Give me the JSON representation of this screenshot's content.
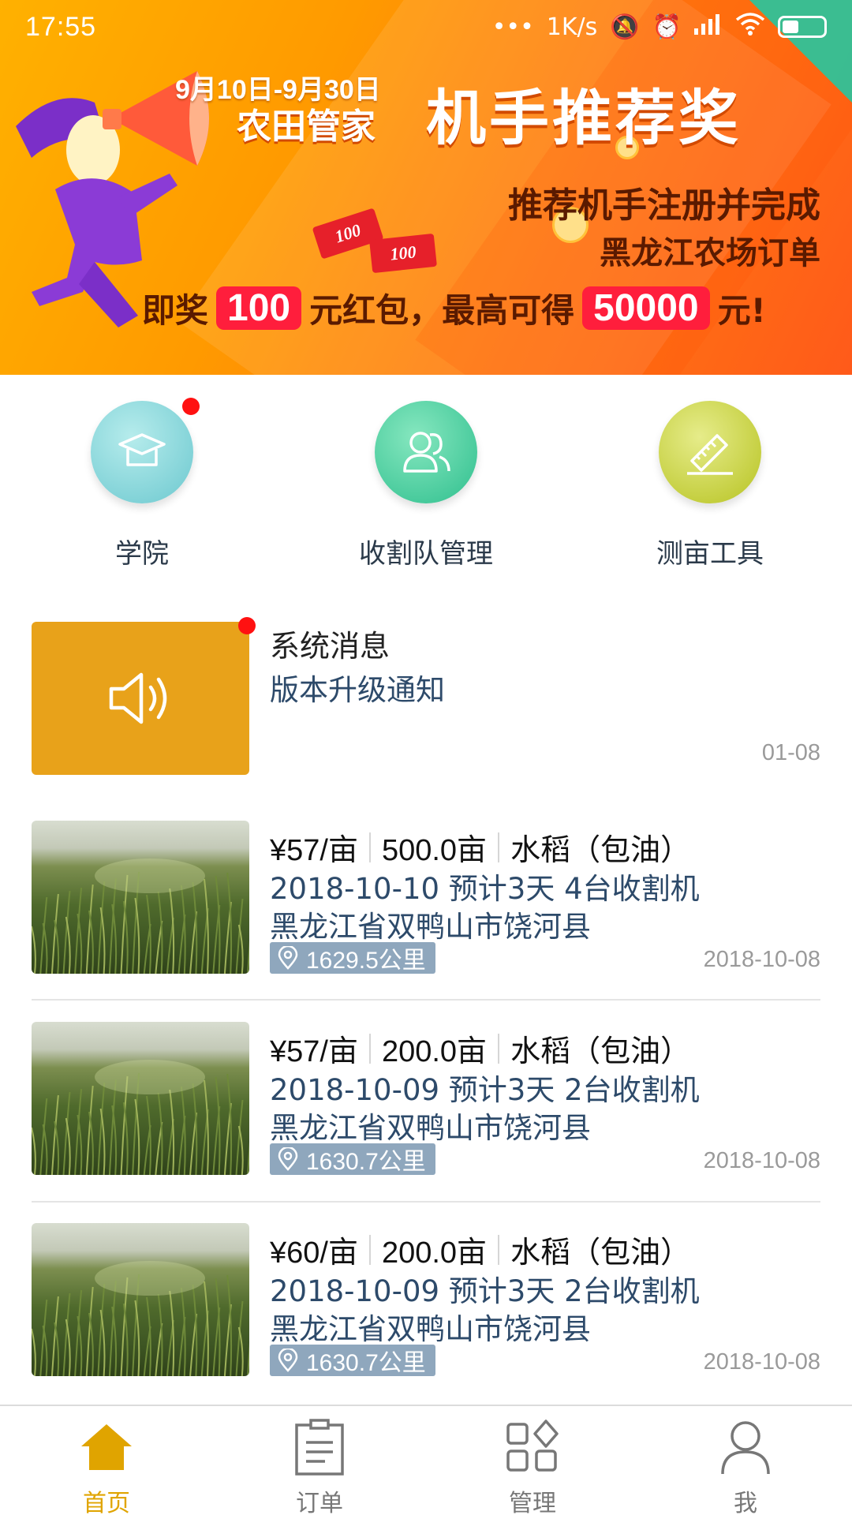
{
  "status_bar": {
    "time": "17:55",
    "net_speed": "1K/s"
  },
  "banner": {
    "date_range": "9月10日-9月30日",
    "brand": "农田管家",
    "title": "机手推荐奖",
    "line1": "推荐机手注册并完成",
    "line2": "黑龙江农场订单",
    "prize_prefix": "即奖",
    "prize_amount": "100",
    "prize_mid": "元红包，最高可得",
    "prize_max": "50000",
    "prize_suffix": "元!",
    "bill_1": "100",
    "bill_2": "100"
  },
  "quick_menu": [
    {
      "label": "学院",
      "icon": "graduation-cap-icon",
      "color": "#7fd3d6",
      "badge": true
    },
    {
      "label": "收割队管理",
      "icon": "users-icon",
      "color": "#3cc79a",
      "badge": false
    },
    {
      "label": "测亩工具",
      "icon": "ruler-icon",
      "color": "#c6d22a",
      "badge": false
    }
  ],
  "system_message": {
    "title": "系统消息",
    "subtitle": "版本升级通知",
    "date": "01-08",
    "icon": "speaker-icon",
    "badge": true
  },
  "orders": [
    {
      "price": "¥57/亩",
      "area": "500.0亩",
      "crop": "水稻（包油）",
      "detail": "2018-10-10 预计3天 4台收割机",
      "location": "黑龙江省双鸭山市饶河县",
      "distance": "1629.5公里",
      "date": "2018-10-08"
    },
    {
      "price": "¥57/亩",
      "area": "200.0亩",
      "crop": "水稻（包油）",
      "detail": "2018-10-09 预计3天 2台收割机",
      "location": "黑龙江省双鸭山市饶河县",
      "distance": "1630.7公里",
      "date": "2018-10-08"
    },
    {
      "price": "¥60/亩",
      "area": "200.0亩",
      "crop": "水稻（包油）",
      "detail": "2018-10-09 预计3天 2台收割机",
      "location": "黑龙江省双鸭山市饶河县",
      "distance": "1630.7公里",
      "date": "2018-10-08"
    }
  ],
  "tab_bar": [
    {
      "label": "首页",
      "icon": "home-icon",
      "active": true
    },
    {
      "label": "订单",
      "icon": "clipboard-icon",
      "active": false
    },
    {
      "label": "管理",
      "icon": "grid-icon",
      "active": false
    },
    {
      "label": "我",
      "icon": "person-icon",
      "active": false
    }
  ],
  "colors": {
    "accent": "#e0a400",
    "link_blue": "#2d4a6a",
    "red_dot": "#ff1111"
  }
}
